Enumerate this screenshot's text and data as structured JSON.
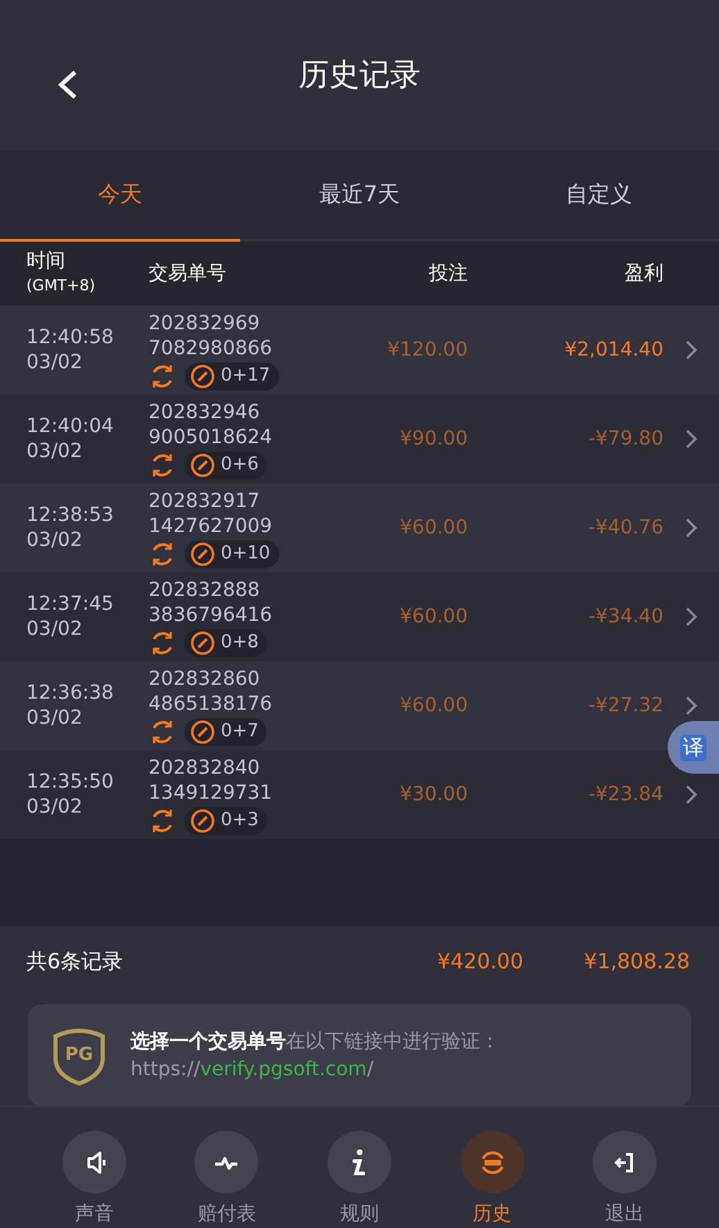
{
  "header": {
    "title": "历史记录"
  },
  "tabs": [
    {
      "label": "今天",
      "selected": true
    },
    {
      "label": "最近7天",
      "selected": false
    },
    {
      "label": "自定义",
      "selected": false
    }
  ],
  "columns": {
    "time": "时间",
    "timezone": "(GMT+8)",
    "order": "交易单号",
    "bet": "投注",
    "profit": "盈利"
  },
  "rows": [
    {
      "time": "12:40:58",
      "date": "03/02",
      "order_1": "202832969",
      "order_2": "7082980866",
      "spins": "0+17",
      "bet": "¥120.00",
      "profit": "¥2,014.40",
      "win": true
    },
    {
      "time": "12:40:04",
      "date": "03/02",
      "order_1": "202832946",
      "order_2": "9005018624",
      "spins": "0+6",
      "bet": "¥90.00",
      "profit": "-¥79.80",
      "win": false
    },
    {
      "time": "12:38:53",
      "date": "03/02",
      "order_1": "202832917",
      "order_2": "1427627009",
      "spins": "0+10",
      "bet": "¥60.00",
      "profit": "-¥40.76",
      "win": false
    },
    {
      "time": "12:37:45",
      "date": "03/02",
      "order_1": "202832888",
      "order_2": "3836796416",
      "spins": "0+8",
      "bet": "¥60.00",
      "profit": "-¥34.40",
      "win": false
    },
    {
      "time": "12:36:38",
      "date": "03/02",
      "order_1": "202832860",
      "order_2": "4865138176",
      "spins": "0+7",
      "bet": "¥60.00",
      "profit": "-¥27.32",
      "win": false
    },
    {
      "time": "12:35:50",
      "date": "03/02",
      "order_1": "202832840",
      "order_2": "1349129731",
      "spins": "0+3",
      "bet": "¥30.00",
      "profit": "-¥23.84",
      "win": false
    }
  ],
  "summary": {
    "count": "共6条记录",
    "bet_total": "¥420.00",
    "profit_total": "¥1,808.28"
  },
  "verify": {
    "badge": "PG",
    "text": "**选择一个交易单号**在以下链接中进行验证：",
    "url_prefix": "https://",
    "url_link": "verify.pgsoft.com",
    "url_suffix": "/"
  },
  "translate_button": "译",
  "nav": [
    {
      "kind": "sound",
      "label": "声音",
      "selected": false
    },
    {
      "kind": "paytable",
      "label": "赔付表",
      "selected": false
    },
    {
      "kind": "rules",
      "label": "规则",
      "selected": false
    },
    {
      "kind": "history",
      "label": "历史",
      "selected": true
    },
    {
      "kind": "exit",
      "label": "退出",
      "selected": false
    }
  ]
}
